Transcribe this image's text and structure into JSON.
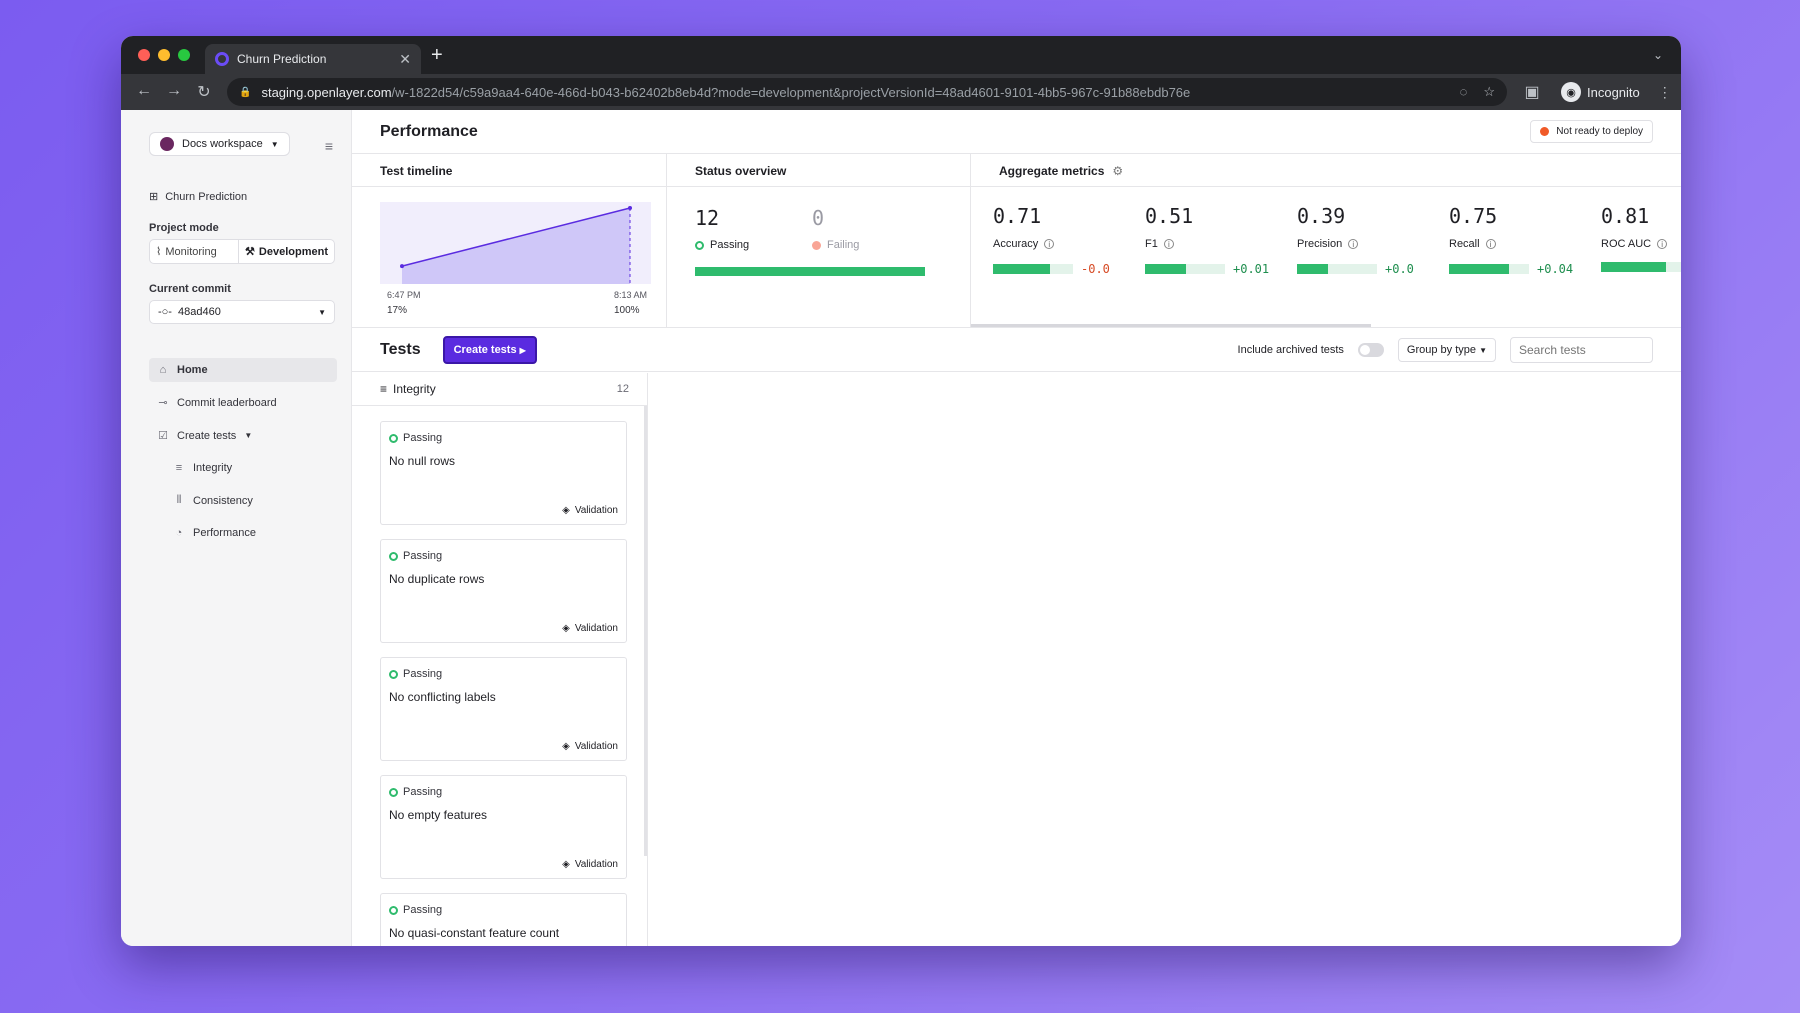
{
  "browser": {
    "tab_title": "Churn Prediction",
    "url_host": "staging.openlayer.com",
    "url_path": "/w-1822d54/c59a9aa4-640e-466d-b043-b62402b8eb4d?mode=development&projectVersionId=48ad4601-9101-4bb5-967c-91b88ebdb76e",
    "incognito_label": "Incognito"
  },
  "sidebar": {
    "workspace": "Docs workspace",
    "project": "Churn Prediction",
    "project_mode_label": "Project mode",
    "modes": [
      "Monitoring",
      "Development"
    ],
    "current_commit_label": "Current commit",
    "commit": "48ad460",
    "nav": [
      {
        "label": "Home",
        "icon": "home-icon"
      },
      {
        "label": "Commit leaderboard",
        "icon": "commit-icon"
      },
      {
        "label": "Create tests",
        "icon": "checkbox-icon"
      },
      {
        "label": "Integrity",
        "icon": "list-icon"
      },
      {
        "label": "Consistency",
        "icon": "columns-icon"
      },
      {
        "label": "Performance",
        "icon": "pie-icon"
      }
    ]
  },
  "header": {
    "title": "Performance",
    "deploy_status": "Not ready to deploy"
  },
  "timeline": {
    "title": "Test timeline",
    "start_time": "6:47 PM",
    "end_time": "8:13 AM",
    "start_pct": "17%",
    "end_pct": "100%",
    "start_value": 17,
    "end_value": 100
  },
  "status": {
    "title": "Status overview",
    "passing_count": "12",
    "passing_label": "Passing",
    "failing_count": "0",
    "failing_label": "Failing"
  },
  "aggregate": {
    "title": "Aggregate metrics",
    "metrics": [
      {
        "value": "0.71",
        "name": "Accuracy",
        "delta": "-0.0",
        "fill": 0.71
      },
      {
        "value": "0.51",
        "name": "F1",
        "delta": "+0.01",
        "fill": 0.51
      },
      {
        "value": "0.39",
        "name": "Precision",
        "delta": "+0.0",
        "fill": 0.39
      },
      {
        "value": "0.75",
        "name": "Recall",
        "delta": "+0.04",
        "fill": 0.75
      },
      {
        "value": "0.81",
        "name": "ROC AUC",
        "delta": "",
        "fill": 0.81
      }
    ]
  },
  "tests": {
    "title": "Tests",
    "create_button": "Create tests",
    "include_archived": "Include archived tests",
    "group_by": "Group by type",
    "search_placeholder": "Search tests",
    "group": {
      "name": "Integrity",
      "count": "12"
    },
    "cards": [
      {
        "status": "Passing",
        "name": "No null rows",
        "tag": "Validation"
      },
      {
        "status": "Passing",
        "name": "No duplicate rows",
        "tag": "Validation"
      },
      {
        "status": "Passing",
        "name": "No conflicting labels",
        "tag": "Validation"
      },
      {
        "status": "Passing",
        "name": "No empty features",
        "tag": "Validation"
      },
      {
        "status": "Passing",
        "name": "No quasi-constant feature count",
        "tag": ""
      }
    ]
  },
  "colors": {
    "accent": "#5a2be0",
    "pass": "#2fbb6d",
    "fail": "#f9a596",
    "deploy_dot": "#f05a28"
  }
}
